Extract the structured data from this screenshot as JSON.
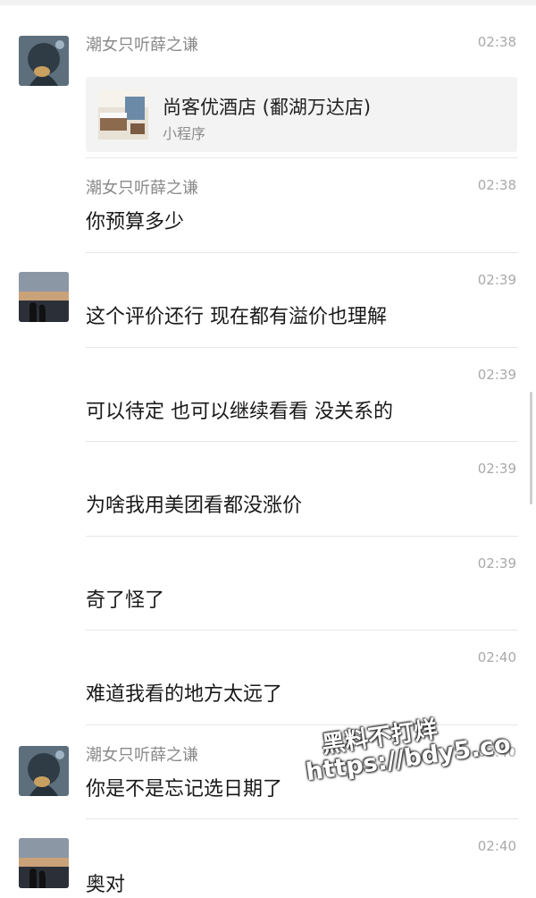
{
  "messages": [
    {
      "sender": "潮女只听薛之谦",
      "time": "02:38",
      "card": {
        "title": "尚客优酒店 (鄱湖万达店)",
        "subtitle": "小程序"
      }
    },
    {
      "sender": "潮女只听薛之谦",
      "time": "02:38",
      "text": "你预算多少"
    },
    {
      "time": "02:39",
      "text": "这个评价还行 现在都有溢价也理解"
    },
    {
      "time": "02:39",
      "text": "可以待定 也可以继续看看 没关系的"
    },
    {
      "time": "02:39",
      "text": "为啥我用美团看都没涨价"
    },
    {
      "time": "02:39",
      "text": "奇了怪了"
    },
    {
      "time": "02:40",
      "text": "难道我看的地方太远了"
    },
    {
      "sender": "潮女只听薛之谦",
      "time": "02:40",
      "text": "你是不是忘记选日期了"
    },
    {
      "time": "02:40",
      "text": "奥对"
    }
  ],
  "watermark": {
    "line1": "黑料不打烊",
    "line2": "https://bdy5.co"
  }
}
